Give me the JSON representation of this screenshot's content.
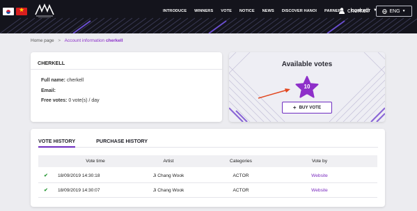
{
  "nav": {
    "items": [
      "INTRODUCE",
      "WINNERS",
      "VOTE",
      "NOTICE",
      "NEWS",
      "DISCOVER HANOI",
      "PARNERS",
      "CONTACT"
    ],
    "username": "cherkell",
    "language": "ENG"
  },
  "breadcrumb": {
    "home": "Home page",
    "separator": ">",
    "current_prefix": "Account information",
    "current_user": "cherkell"
  },
  "account": {
    "title": "CHERKELL",
    "full_name_label": "Full name:",
    "full_name_value": "cherkell",
    "email_label": "Email:",
    "free_votes_label": "Free votes:",
    "free_votes_value": "0 vote(s) / day"
  },
  "votes": {
    "title": "Available votes",
    "count": "10",
    "buy_label": "BUY VOTE",
    "buy_icon": "+"
  },
  "history": {
    "tabs": [
      "VOTE HISTORY",
      "PURCHASE HISTORY"
    ],
    "columns": [
      "Vote time",
      "Artist",
      "Categories",
      "Vote by"
    ],
    "rows": [
      {
        "time": "18/09/2019 14:30:18",
        "artist": "Ji Chang Wook",
        "category": "ACTOR",
        "vote_by": "Website"
      },
      {
        "time": "18/09/2019 14:30:07",
        "artist": "Ji Chang Wook",
        "category": "ACTOR",
        "vote_by": "Website"
      }
    ]
  },
  "colors": {
    "accent": "#6d2bc0",
    "link": "#7b2bbf",
    "check": "#2e9b3a",
    "nav_bg": "#14141c"
  }
}
